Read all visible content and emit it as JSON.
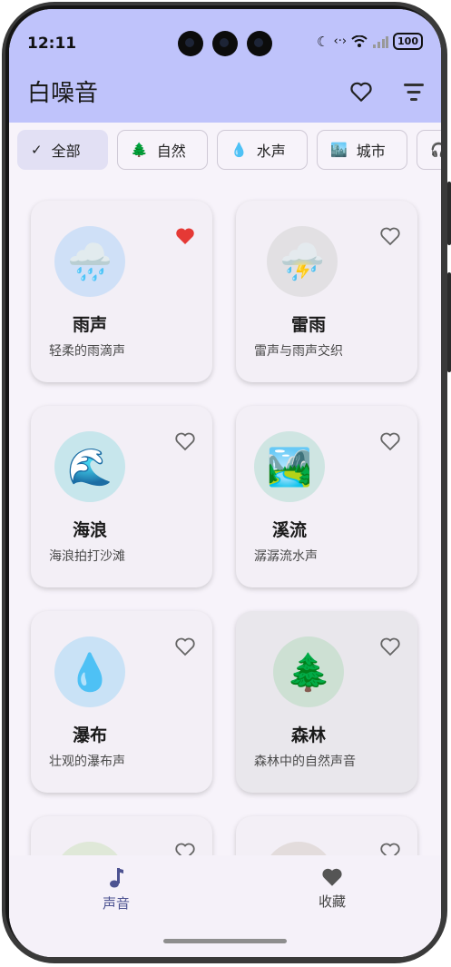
{
  "status_bar": {
    "time": "12:11",
    "battery": "100"
  },
  "app_bar": {
    "title": "白噪音"
  },
  "chips": [
    {
      "label": "全部",
      "icon": "✓",
      "selected": true
    },
    {
      "label": "自然",
      "icon": "🌲",
      "selected": false
    },
    {
      "label": "水声",
      "icon": "💧",
      "selected": false
    },
    {
      "label": "城市",
      "icon": "🏙️",
      "selected": false
    }
  ],
  "sounds": [
    {
      "title": "雨声",
      "desc": "轻柔的雨滴声",
      "emoji": "🌧️",
      "favorite": true
    },
    {
      "title": "雷雨",
      "desc": "雷声与雨声交织",
      "emoji": "⛈️",
      "favorite": false
    },
    {
      "title": "海浪",
      "desc": "海浪拍打沙滩",
      "emoji": "🌊",
      "favorite": false
    },
    {
      "title": "溪流",
      "desc": "潺潺流水声",
      "emoji": "🏞️",
      "favorite": false
    },
    {
      "title": "瀑布",
      "desc": "壮观的瀑布声",
      "emoji": "💧",
      "favorite": false
    },
    {
      "title": "森林",
      "desc": "森林中的自然声音",
      "emoji": "🌲",
      "favorite": false
    }
  ],
  "bottom_nav": [
    {
      "label": "声音",
      "icon": "music-note-icon",
      "active": true
    },
    {
      "label": "收藏",
      "icon": "heart-icon",
      "active": false
    }
  ],
  "colors": {
    "app_bar": "#bfc3fb",
    "accent": "#4d5391",
    "favorite": "#e53935"
  }
}
